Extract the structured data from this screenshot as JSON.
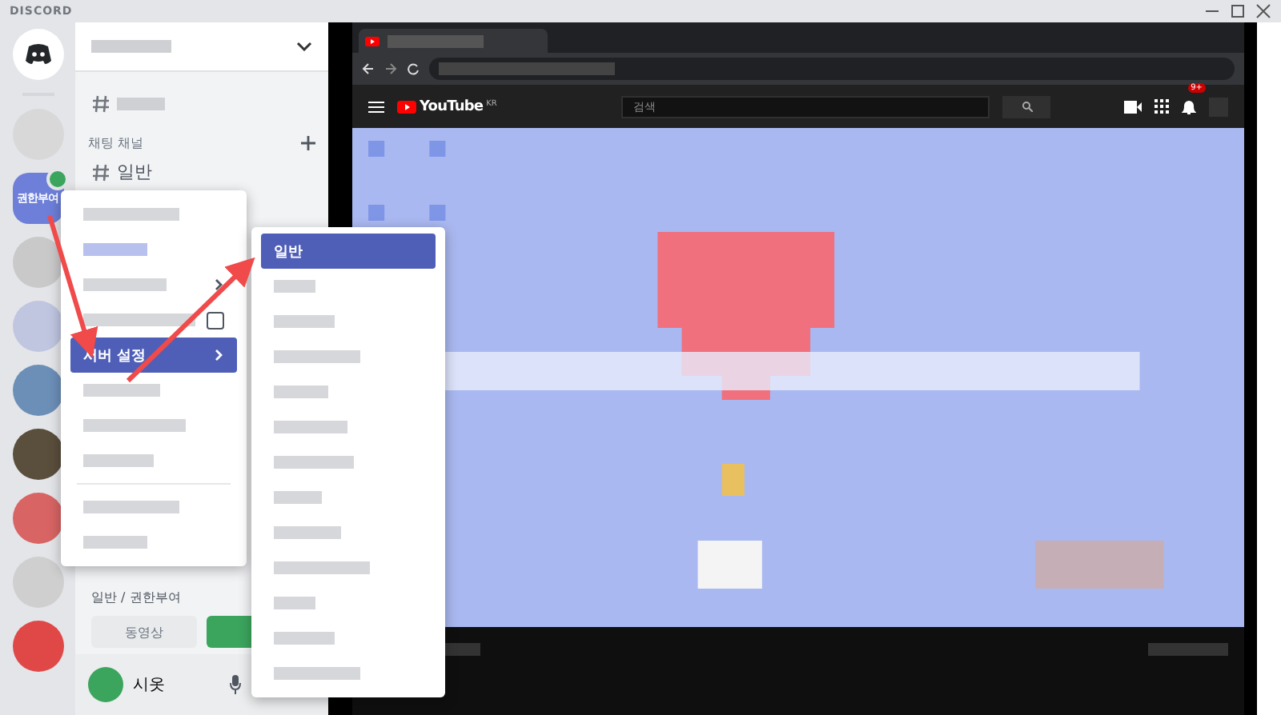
{
  "window": {
    "title": "DISCORD"
  },
  "server_rail": {
    "servers": [
      {
        "kind": "blurred",
        "color": "#d8d8d8",
        "selected": false
      },
      {
        "kind": "named",
        "label": "권한부여",
        "color": "#6d7fd9",
        "selected": true,
        "badge": true
      },
      {
        "kind": "blurred",
        "color": "#c9c9c9",
        "selected": false
      },
      {
        "kind": "blurred",
        "color": "#c0c6e0",
        "selected": false
      },
      {
        "kind": "blurred",
        "color": "#6c8fb8",
        "selected": false
      },
      {
        "kind": "blurred",
        "color": "#5a4e3c",
        "selected": false
      },
      {
        "kind": "blurred",
        "color": "#d86464",
        "selected": false
      },
      {
        "kind": "blurred",
        "color": "#cfcfcf",
        "selected": false
      },
      {
        "kind": "blurred",
        "color": "#e04848",
        "selected": false
      }
    ]
  },
  "channel_panel": {
    "category": "채팅 채널",
    "channels": [
      {
        "kind": "blurred",
        "selected": false
      },
      {
        "kind": "text",
        "name": "일반",
        "selected": false
      }
    ],
    "voice_location": "일반 / 권한부여",
    "video_button": "동영상",
    "user": {
      "name": "시옷"
    }
  },
  "context_menu": {
    "items": [
      {
        "kind": "blurred",
        "selected": false
      },
      {
        "kind": "blurred",
        "accent": true,
        "selected": false
      },
      {
        "kind": "blurred",
        "submenu": true,
        "selected": false
      },
      {
        "kind": "blurred",
        "checkbox": true,
        "checked": false,
        "selected": false
      },
      {
        "kind": "text",
        "label": "서버 설정",
        "submenu": true,
        "selected": true
      },
      {
        "kind": "blurred",
        "selected": false
      },
      {
        "kind": "blurred",
        "selected": false
      },
      {
        "kind": "blurred",
        "selected": false
      },
      {
        "kind": "separator"
      },
      {
        "kind": "blurred",
        "selected": false
      },
      {
        "kind": "blurred",
        "selected": false
      }
    ]
  },
  "submenu": {
    "items": [
      {
        "kind": "text",
        "label": "일반",
        "selected": true
      },
      {
        "kind": "blurred",
        "selected": false
      },
      {
        "kind": "blurred",
        "selected": false
      },
      {
        "kind": "blurred",
        "selected": false
      },
      {
        "kind": "blurred",
        "selected": false
      },
      {
        "kind": "blurred",
        "selected": false
      },
      {
        "kind": "blurred",
        "selected": false
      },
      {
        "kind": "blurred",
        "selected": false
      },
      {
        "kind": "blurred",
        "selected": false
      },
      {
        "kind": "blurred",
        "selected": false
      },
      {
        "kind": "blurred",
        "selected": false
      },
      {
        "kind": "blurred",
        "selected": false
      },
      {
        "kind": "blurred",
        "selected": false
      }
    ]
  },
  "youtube": {
    "logo": "YouTube",
    "region": "KR",
    "search": {
      "placeholder": "검색"
    },
    "notifications": "9+"
  }
}
